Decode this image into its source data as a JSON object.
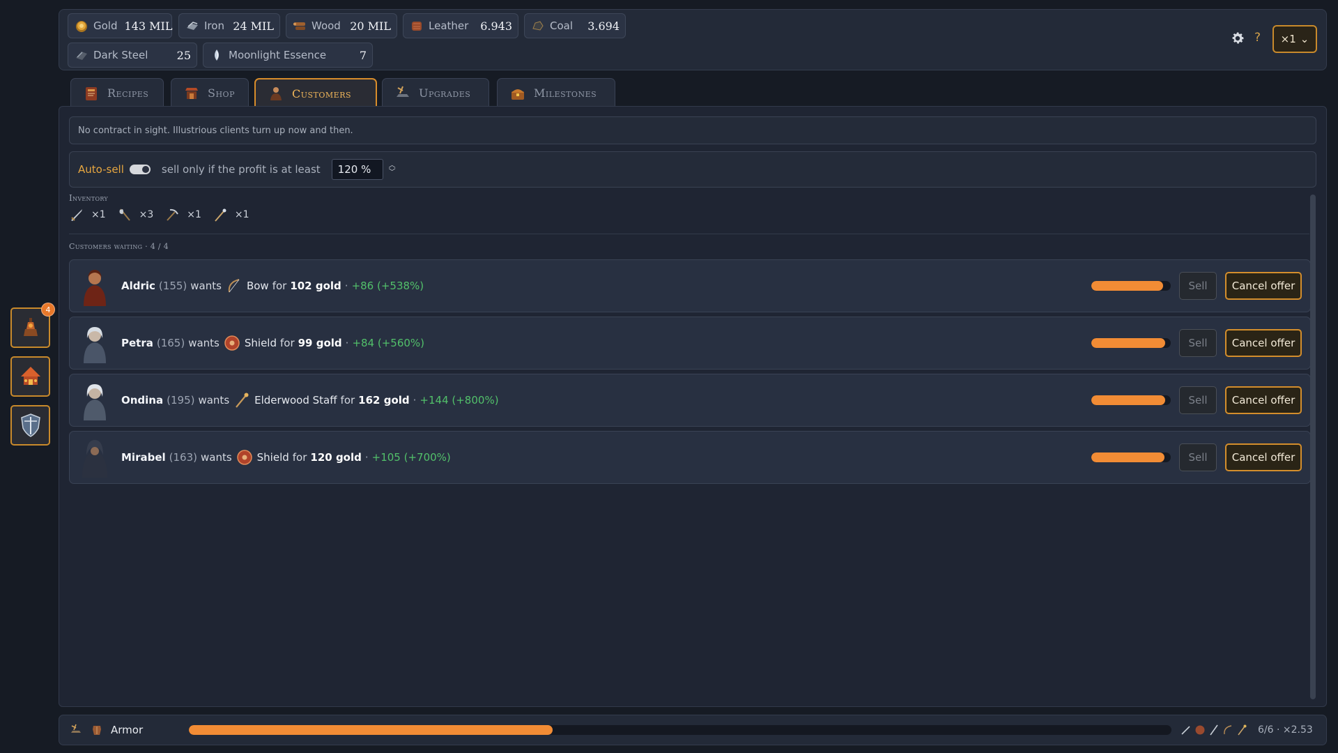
{
  "resources": [
    {
      "name": "Gold",
      "value": "143 MIL",
      "icon": "gold-icon"
    },
    {
      "name": "Iron",
      "value": "24 MIL",
      "icon": "iron-icon"
    },
    {
      "name": "Wood",
      "value": "20 MIL",
      "icon": "wood-icon"
    },
    {
      "name": "Leather",
      "value": "6.943",
      "icon": "leather-icon"
    },
    {
      "name": "Coal",
      "value": "3.694",
      "icon": "coal-icon"
    },
    {
      "name": "Dark Steel",
      "value": "25",
      "icon": "dark-steel-icon"
    },
    {
      "name": "Moonlight Essence",
      "value": "7",
      "icon": "moonlight-essence-icon"
    }
  ],
  "header": {
    "help_label": "?",
    "speed_label": "×1",
    "speed_caret": "⌄"
  },
  "sidebar": {
    "badge": "4"
  },
  "tabs": [
    {
      "label": "Recipes",
      "active": false
    },
    {
      "label": "Shop",
      "active": false
    },
    {
      "label": "Customers",
      "active": true
    },
    {
      "label": "Upgrades",
      "active": false
    },
    {
      "label": "Milestones",
      "active": false
    }
  ],
  "notice": "No contract in sight. Illustrious clients turn up now and then.",
  "autosell": {
    "label": "Auto-sell",
    "enabled": true,
    "description": "sell only if the profit is at least",
    "threshold": "120 %"
  },
  "inventory": {
    "title": "Inventory",
    "items": [
      {
        "icon": "sword-icon",
        "count": "×1"
      },
      {
        "icon": "axe-icon",
        "count": "×3"
      },
      {
        "icon": "pickaxe-icon",
        "count": "×1"
      },
      {
        "icon": "staff-icon",
        "count": "×1"
      }
    ]
  },
  "customers": {
    "title": "Customers waiting · 4 / 4",
    "wants_label": "wants",
    "for_label": "for",
    "sell_label": "Sell",
    "cancel_label": "Cancel offer",
    "list": [
      {
        "name": "Aldric",
        "level": "(155)",
        "item": "Bow",
        "price": "102 gold",
        "profit": "+86 (+538%)",
        "patience": 0.9,
        "item_icon": "bow-icon"
      },
      {
        "name": "Petra",
        "level": "(165)",
        "item": "Shield",
        "price": "99 gold",
        "profit": "+84 (+560%)",
        "patience": 0.93,
        "item_icon": "shield-icon"
      },
      {
        "name": "Ondina",
        "level": "(195)",
        "item": "Elderwood Staff",
        "price": "162 gold",
        "profit": "+144 (+800%)",
        "patience": 0.93,
        "item_icon": "staff-icon"
      },
      {
        "name": "Mirabel",
        "level": "(163)",
        "item": "Shield",
        "price": "120 gold",
        "profit": "+105 (+700%)",
        "patience": 0.92,
        "item_icon": "shield-icon"
      }
    ]
  },
  "bottom": {
    "label": "Armor",
    "progress": 0.37,
    "status": "6/6 · ×2.53"
  },
  "colors": {
    "accent": "#d98d2b",
    "progress": "#f28c35",
    "profit": "#52c06a"
  }
}
